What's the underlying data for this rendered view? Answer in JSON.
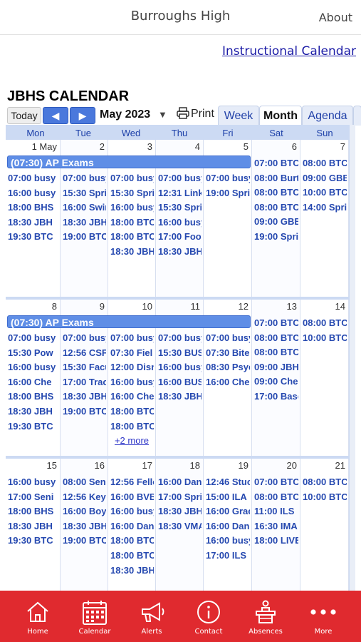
{
  "header": {
    "title": "Burroughs High",
    "about": "About"
  },
  "links": {
    "instructional": "Instructional Calendar"
  },
  "calendar": {
    "title": "JBHS CALENDAR",
    "today": "Today",
    "prev": "◀",
    "next": "▶",
    "month": "May 2023",
    "caret": "▼",
    "print": "Print",
    "tabs": [
      "Week",
      "Month",
      "Agenda"
    ],
    "active_tab": "Month",
    "days": [
      "Mon",
      "Tue",
      "Wed",
      "Thu",
      "Fri",
      "Sat",
      "Sun"
    ],
    "weeks": [
      {
        "dates": [
          "1 May",
          "2",
          "3",
          "4",
          "5",
          "6",
          "7"
        ],
        "allday": "(07:30) AP Exams",
        "cols": [
          [
            [
              "07:00",
              "busy"
            ],
            [
              "16:00",
              "busy"
            ],
            [
              "18:00",
              "BHS"
            ],
            [
              "18:30",
              "JBH"
            ],
            [
              "19:30",
              "BTC"
            ]
          ],
          [
            [
              "07:00",
              "busy"
            ],
            [
              "15:30",
              "Spri"
            ],
            [
              "16:00",
              "Swir"
            ],
            [
              "18:30",
              "JBH"
            ],
            [
              "19:00",
              "BTC"
            ]
          ],
          [
            [
              "07:00",
              "busy"
            ],
            [
              "15:30",
              "Spri"
            ],
            [
              "16:00",
              "busy"
            ],
            [
              "18:00",
              "BTC"
            ],
            [
              "18:00",
              "BTC"
            ],
            [
              "18:30",
              "JBH"
            ]
          ],
          [
            [
              "07:00",
              "busy"
            ],
            [
              "12:31",
              "Link"
            ],
            [
              "15:30",
              "Spri"
            ],
            [
              "16:00",
              "busy"
            ],
            [
              "17:00",
              "Foot"
            ],
            [
              "18:30",
              "JBH"
            ]
          ],
          [
            [
              "07:00",
              "busy"
            ],
            [
              "19:00",
              "Spri"
            ]
          ],
          [
            [
              "07:00",
              "BTC"
            ],
            [
              "08:00",
              "Burt"
            ],
            [
              "08:00",
              "BTC"
            ],
            [
              "08:00",
              "BTC"
            ],
            [
              "09:00",
              "GBB"
            ],
            [
              "19:00",
              "Spri"
            ]
          ],
          [
            [
              "08:00",
              "BTC"
            ],
            [
              "09:00",
              "GBB"
            ],
            [
              "10:00",
              "BTC"
            ],
            [
              "14:00",
              "Spri"
            ]
          ]
        ]
      },
      {
        "dates": [
          "8",
          "9",
          "10",
          "11",
          "12",
          "13",
          "14"
        ],
        "allday": "(07:30) AP Exams",
        "cols": [
          [
            [
              "07:00",
              "busy"
            ],
            [
              "15:30",
              "Pow"
            ],
            [
              "16:00",
              "busy"
            ],
            [
              "16:00",
              "Che"
            ],
            [
              "18:00",
              "BHS"
            ],
            [
              "18:30",
              "JBH"
            ],
            [
              "19:30",
              "BTC"
            ]
          ],
          [
            [
              "07:00",
              "busy"
            ],
            [
              "12:56",
              "CSF"
            ],
            [
              "15:30",
              "Facu"
            ],
            [
              "17:00",
              "Trac"
            ],
            [
              "18:30",
              "JBH"
            ],
            [
              "19:00",
              "BTC"
            ]
          ],
          [
            [
              "07:00",
              "busy"
            ],
            [
              "07:30",
              "Fiel"
            ],
            [
              "12:00",
              "Disn"
            ],
            [
              "16:00",
              "busy"
            ],
            [
              "16:00",
              "Che"
            ],
            [
              "18:00",
              "BTC"
            ],
            [
              "18:00",
              "BTC"
            ]
          ],
          [
            [
              "07:00",
              "busy"
            ],
            [
              "15:30",
              "BUS"
            ],
            [
              "16:00",
              "busy"
            ],
            [
              "16:00",
              "BUS"
            ],
            [
              "18:30",
              "JBH"
            ]
          ],
          [
            [
              "07:00",
              "busy"
            ],
            [
              "07:30",
              "Bite"
            ],
            [
              "08:30",
              "Psyc"
            ],
            [
              "16:00",
              "Che"
            ]
          ],
          [
            [
              "07:00",
              "BTC"
            ],
            [
              "08:00",
              "BTC"
            ],
            [
              "08:00",
              "BTC"
            ],
            [
              "09:00",
              "JBH"
            ],
            [
              "09:00",
              "Che"
            ],
            [
              "17:00",
              "Base"
            ]
          ],
          [
            [
              "08:00",
              "BTC"
            ],
            [
              "10:00",
              "BTC"
            ]
          ]
        ],
        "more": "+2 more"
      },
      {
        "dates": [
          "15",
          "16",
          "17",
          "18",
          "19",
          "20",
          "21"
        ],
        "cols": [
          [
            [
              "16:00",
              "busy"
            ],
            [
              "17:00",
              "Seni"
            ],
            [
              "18:00",
              "BHS"
            ],
            [
              "18:30",
              "JBH"
            ],
            [
              "19:30",
              "BTC"
            ]
          ],
          [
            [
              "08:00",
              "Seni"
            ],
            [
              "12:56",
              "Key"
            ],
            [
              "16:00",
              "Boys"
            ],
            [
              "18:30",
              "JBH"
            ],
            [
              "19:00",
              "BTC"
            ]
          ],
          [
            [
              "12:56",
              "Fellc"
            ],
            [
              "16:00",
              "BVB"
            ],
            [
              "16:00",
              "busy"
            ],
            [
              "16:00",
              "Dan"
            ],
            [
              "18:00",
              "BTC"
            ],
            [
              "18:00",
              "BTC"
            ],
            [
              "18:30",
              "JBH"
            ]
          ],
          [
            [
              "16:00",
              "Dan"
            ],
            [
              "17:00",
              "Spri"
            ],
            [
              "18:30",
              "JBH"
            ],
            [
              "18:30",
              "VMA"
            ]
          ],
          [
            [
              "12:46",
              "Stuc"
            ],
            [
              "15:00",
              "ILA"
            ],
            [
              "16:00",
              "Grac"
            ],
            [
              "16:00",
              "Dan"
            ],
            [
              "16:00",
              "busy"
            ],
            [
              "17:00",
              "ILS"
            ]
          ],
          [
            [
              "07:00",
              "BTC"
            ],
            [
              "08:00",
              "BTC"
            ],
            [
              "11:00",
              "ILS"
            ],
            [
              "16:30",
              "IMA"
            ],
            [
              "18:00",
              "LIVE"
            ]
          ],
          [
            [
              "08:00",
              "BTC"
            ],
            [
              "10:00",
              "BTC"
            ]
          ]
        ]
      }
    ]
  },
  "tabbar": {
    "items": [
      {
        "label": "Home",
        "icon": "home-icon"
      },
      {
        "label": "Calendar",
        "icon": "calendar-icon"
      },
      {
        "label": "Alerts",
        "icon": "megaphone-icon"
      },
      {
        "label": "Contact",
        "icon": "info-icon"
      },
      {
        "label": "Absences",
        "icon": "desk-icon"
      },
      {
        "label": "More",
        "icon": "more-icon"
      }
    ],
    "color": "#e02a2f"
  }
}
